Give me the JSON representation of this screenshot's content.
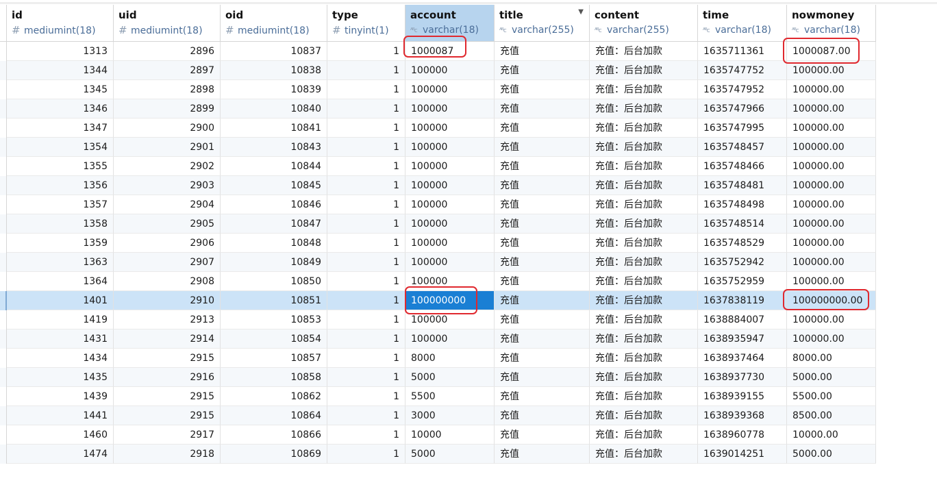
{
  "columns": [
    {
      "name": "id",
      "type": "mediumint(18)",
      "icon": "numeric-type-icon"
    },
    {
      "name": "uid",
      "type": "mediumint(18)",
      "icon": "numeric-type-icon"
    },
    {
      "name": "oid",
      "type": "mediumint(18)",
      "icon": "numeric-type-icon"
    },
    {
      "name": "type",
      "type": "tinyint(1)",
      "icon": "numeric-type-icon"
    },
    {
      "name": "account",
      "type": "varchar(18)",
      "icon": "text-type-icon"
    },
    {
      "name": "title",
      "type": "varchar(255)",
      "icon": "text-type-icon"
    },
    {
      "name": "content",
      "type": "varchar(255)",
      "icon": "text-type-icon"
    },
    {
      "name": "time",
      "type": "varchar(18)",
      "icon": "text-type-icon"
    },
    {
      "name": "nowmoney",
      "type": "varchar(18)",
      "icon": "text-type-icon"
    }
  ],
  "rows": [
    [
      "1313",
      "2896",
      "10837",
      "1",
      "1000087",
      "充值",
      "充值：后台加款",
      "1635711361",
      "1000087.00"
    ],
    [
      "1344",
      "2897",
      "10838",
      "1",
      "100000",
      "充值",
      "充值：后台加款",
      "1635747752",
      "100000.00"
    ],
    [
      "1345",
      "2898",
      "10839",
      "1",
      "100000",
      "充值",
      "充值：后台加款",
      "1635747952",
      "100000.00"
    ],
    [
      "1346",
      "2899",
      "10840",
      "1",
      "100000",
      "充值",
      "充值：后台加款",
      "1635747966",
      "100000.00"
    ],
    [
      "1347",
      "2900",
      "10841",
      "1",
      "100000",
      "充值",
      "充值：后台加款",
      "1635747995",
      "100000.00"
    ],
    [
      "1354",
      "2901",
      "10843",
      "1",
      "100000",
      "充值",
      "充值：后台加款",
      "1635748457",
      "100000.00"
    ],
    [
      "1355",
      "2902",
      "10844",
      "1",
      "100000",
      "充值",
      "充值：后台加款",
      "1635748466",
      "100000.00"
    ],
    [
      "1356",
      "2903",
      "10845",
      "1",
      "100000",
      "充值",
      "充值：后台加款",
      "1635748481",
      "100000.00"
    ],
    [
      "1357",
      "2904",
      "10846",
      "1",
      "100000",
      "充值",
      "充值：后台加款",
      "1635748498",
      "100000.00"
    ],
    [
      "1358",
      "2905",
      "10847",
      "1",
      "100000",
      "充值",
      "充值：后台加款",
      "1635748514",
      "100000.00"
    ],
    [
      "1359",
      "2906",
      "10848",
      "1",
      "100000",
      "充值",
      "充值：后台加款",
      "1635748529",
      "100000.00"
    ],
    [
      "1363",
      "2907",
      "10849",
      "1",
      "100000",
      "充值",
      "充值：后台加款",
      "1635752942",
      "100000.00"
    ],
    [
      "1364",
      "2908",
      "10850",
      "1",
      "100000",
      "充值",
      "充值：后台加款",
      "1635752959",
      "100000.00"
    ],
    [
      "1401",
      "2910",
      "10851",
      "1",
      "100000000",
      "充值",
      "充值：后台加款",
      "1637838119",
      "100000000.00"
    ],
    [
      "1419",
      "2913",
      "10853",
      "1",
      "100000",
      "充值",
      "充值：后台加款",
      "1638884007",
      "100000.00"
    ],
    [
      "1431",
      "2914",
      "10854",
      "1",
      "100000",
      "充值",
      "充值：后台加款",
      "1638935947",
      "100000.00"
    ],
    [
      "1434",
      "2915",
      "10857",
      "1",
      "8000",
      "充值",
      "充值：后台加款",
      "1638937464",
      "8000.00"
    ],
    [
      "1435",
      "2916",
      "10858",
      "1",
      "5000",
      "充值",
      "充值：后台加款",
      "1638937730",
      "5000.00"
    ],
    [
      "1439",
      "2915",
      "10862",
      "1",
      "5500",
      "充值",
      "充值：后台加款",
      "1638939155",
      "5500.00"
    ],
    [
      "1441",
      "2915",
      "10864",
      "1",
      "3000",
      "充值",
      "充值：后台加款",
      "1638939368",
      "8500.00"
    ],
    [
      "1460",
      "2917",
      "10866",
      "1",
      "10000",
      "充值",
      "充值：后台加款",
      "1638960778",
      "10000.00"
    ],
    [
      "1474",
      "2918",
      "10869",
      "1",
      "5000",
      "充值",
      "充值：后台加款",
      "1639014251",
      "5000.00"
    ]
  ],
  "selection": {
    "selected_row": 13,
    "active_column": 4
  },
  "filter_column": 5,
  "colors": {
    "selected_row": "#cce3f7",
    "active_cell": "#1a7fd4",
    "active_header": "#b7d4ee",
    "annotation": "#e0282e"
  }
}
